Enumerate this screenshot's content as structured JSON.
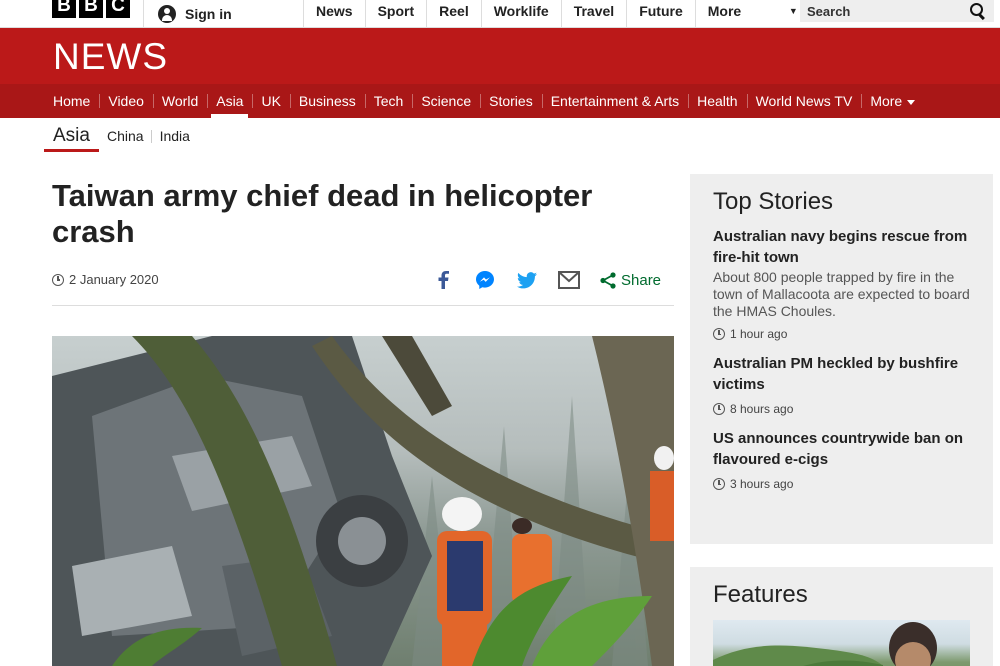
{
  "topbar": {
    "logo_letters": [
      "B",
      "B",
      "C"
    ],
    "signin_label": "Sign in",
    "nav": [
      "News",
      "Sport",
      "Reel",
      "Worklife",
      "Travel",
      "Future"
    ],
    "more_label": "More",
    "search_placeholder": "Search"
  },
  "banner": {
    "title": "NEWS",
    "color": "#bb1919"
  },
  "rednav": {
    "items": [
      "Home",
      "Video",
      "World",
      "Asia",
      "UK",
      "Business",
      "Tech",
      "Science",
      "Stories",
      "Entertainment & Arts",
      "Health",
      "World News TV"
    ],
    "active": "Asia",
    "more_label": "More"
  },
  "subnav": {
    "section": "Asia",
    "items": [
      "China",
      "India"
    ]
  },
  "article": {
    "headline": "Taiwan army chief dead in helicopter crash",
    "date": "2 January 2020",
    "share_label": "Share",
    "share_icons": [
      "facebook-icon",
      "messenger-icon",
      "twitter-icon",
      "email-icon",
      "share-icon"
    ]
  },
  "top_stories": {
    "heading": "Top Stories",
    "stories": [
      {
        "title": "Australian navy begins rescue from fire-hit town",
        "summary": "About 800 people trapped by fire in the town of Mallacoota are expected to board the HMAS Choules.",
        "time": "1 hour ago"
      },
      {
        "title": "Australian PM heckled by bushfire victims",
        "summary": "",
        "time": "8 hours ago"
      },
      {
        "title": "US announces countrywide ban on flavoured e-cigs",
        "summary": "",
        "time": "3 hours ago"
      }
    ]
  },
  "features": {
    "heading": "Features"
  }
}
